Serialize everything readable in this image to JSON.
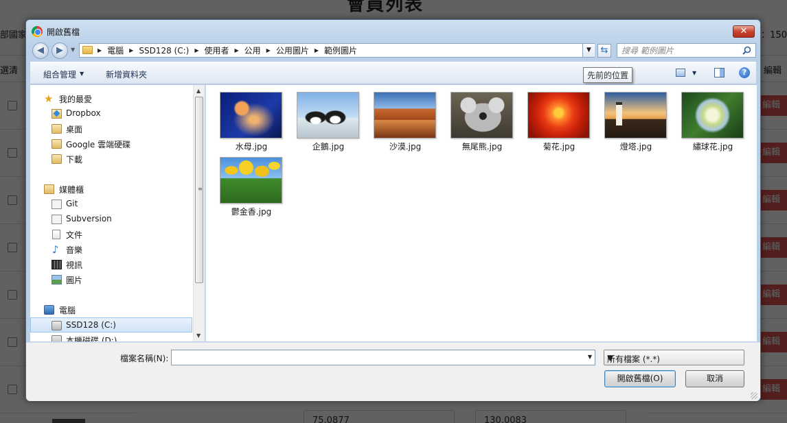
{
  "background_page": {
    "title": "會員列表",
    "left_label": "部國家",
    "right_label": "：150",
    "select_all": "選清",
    "edit_header": "編輯",
    "edit_label": "編輯",
    "field_value_1": "75.0877",
    "field_value_2": "130.0083"
  },
  "dialog": {
    "title": "開啟舊檔",
    "close_icon": "close-icon",
    "breadcrumb": [
      "電腦",
      "SSD128 (C:)",
      "使用者",
      "公用",
      "公用圖片",
      "範例圖片"
    ],
    "search": {
      "placeholder": "搜尋 範例圖片"
    },
    "toolbar": {
      "organize": "組合管理",
      "new_folder": "新增資料夾",
      "tooltip": "先前的位置"
    },
    "nav": {
      "favorites": "我的最愛",
      "dropbox": "Dropbox",
      "desktop": "桌面",
      "google_drive": "Google 雲端硬碟",
      "downloads": "下載",
      "libraries": "媒體櫃",
      "git": "Git",
      "subversion": "Subversion",
      "documents": "文件",
      "music": "音樂",
      "videos": "視訊",
      "pictures": "圖片",
      "computer": "電腦",
      "drive_c": "SSD128 (C:)",
      "drive_d": "本機磁碟 (D:)"
    },
    "files": [
      {
        "name": "水母.jpg"
      },
      {
        "name": "企鵝.jpg"
      },
      {
        "name": "沙漠.jpg"
      },
      {
        "name": "無尾熊.jpg"
      },
      {
        "name": "菊花.jpg"
      },
      {
        "name": "燈塔.jpg"
      },
      {
        "name": "繡球花.jpg"
      },
      {
        "name": "鬱金香.jpg"
      }
    ],
    "bottom": {
      "filename_label": "檔案名稱(N):",
      "filename_value": "",
      "filter": "所有檔案 (*.*)",
      "open_button": "開啟舊檔(O)",
      "cancel_button": "取消"
    }
  },
  "colors": {
    "dialog_frame": "#b9d0e8",
    "close_button": "#c7442f",
    "edit_button": "#d9534f"
  }
}
